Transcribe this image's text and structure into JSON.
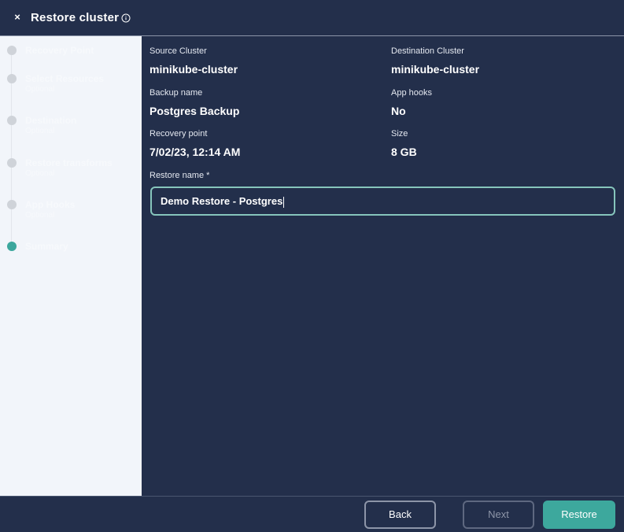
{
  "header": {
    "close_label": "×",
    "title": "Restore cluster",
    "info_icon": "info-circle-icon"
  },
  "stepper": {
    "steps": [
      {
        "label": "Recovery Point",
        "sub": "",
        "state": "complete"
      },
      {
        "label": "Select Resources",
        "sub": "Optional",
        "state": "complete"
      },
      {
        "label": "Destination",
        "sub": "Optional",
        "state": "complete"
      },
      {
        "label": "Restore transforms",
        "sub": "Optional",
        "state": "complete"
      },
      {
        "label": "App Hooks",
        "sub": "Optional",
        "state": "complete"
      },
      {
        "label": "Summary",
        "sub": "",
        "state": "active"
      }
    ]
  },
  "summary": {
    "source_cluster_label": "Source Cluster",
    "source_cluster_value": "minikube-cluster",
    "destination_cluster_label": "Destination Cluster",
    "destination_cluster_value": "minikube-cluster",
    "backup_name_label": "Backup name",
    "backup_name_value": "Postgres Backup",
    "app_hooks_label": "App hooks",
    "app_hooks_value": "No",
    "recovery_point_label": "Recovery point",
    "recovery_point_value": "7/02/23, 12:14 AM",
    "size_label": "Size",
    "size_value": "8 GB",
    "restore_name_label": "Restore name *",
    "restore_name_value": "Demo Restore - Postgres"
  },
  "footer": {
    "back_label": "Back",
    "next_label": "Next",
    "restore_label": "Restore"
  },
  "colors": {
    "background": "#232f4b",
    "sidebar": "#f2f5fa",
    "accent": "#3da89d",
    "input_border": "#86c5bc"
  }
}
